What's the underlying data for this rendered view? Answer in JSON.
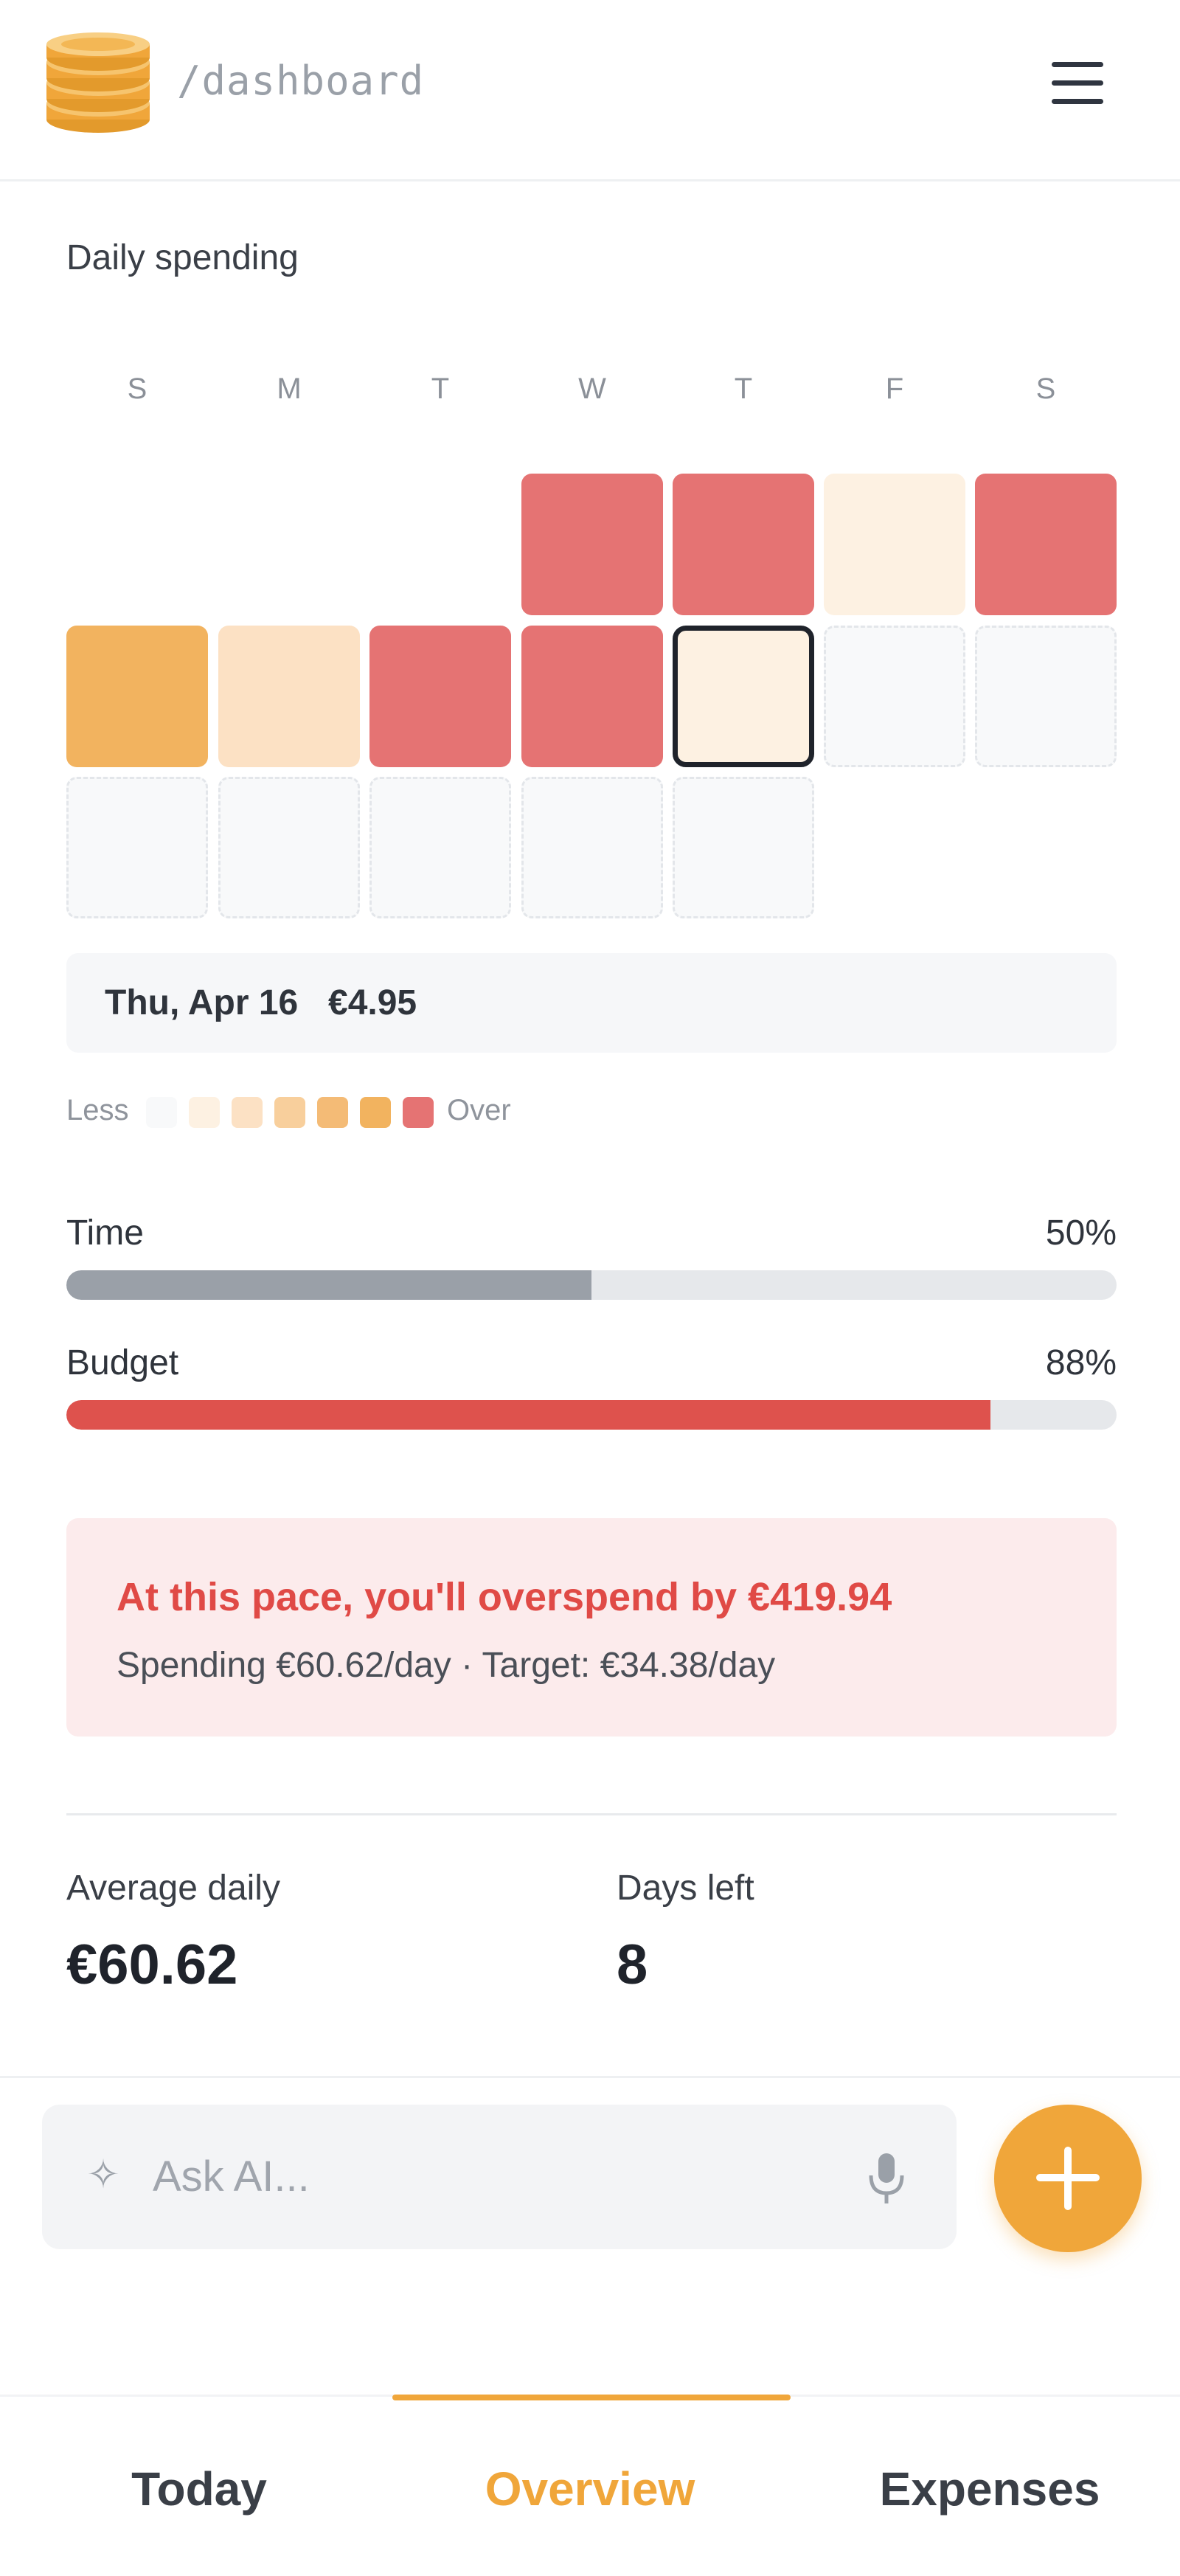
{
  "header": {
    "path": "/dashboard",
    "logo_icon": "coin-stack-icon",
    "menu_icon": "hamburger-menu-icon"
  },
  "daily_spending": {
    "title": "Daily spending",
    "weekdays": [
      "S",
      "M",
      "T",
      "W",
      "T",
      "F",
      "S"
    ],
    "colors": {
      "empty": "#f8f9fa",
      "level1": "#fdf1e2",
      "level2": "#fce1c4",
      "level3": "#f8cf9c",
      "level4": "#f4bb76",
      "level5": "#f2b35f",
      "over": "#e57373"
    },
    "weeks": [
      [
        "none",
        "none",
        "none",
        "over",
        "over",
        "level1",
        "over"
      ],
      [
        "level5",
        "level2",
        "over",
        "over",
        "level1-selected",
        "empty",
        "empty"
      ],
      [
        "empty",
        "empty",
        "empty",
        "empty",
        "empty",
        "none",
        "none"
      ]
    ],
    "selected": {
      "date": "Thu, Apr 16",
      "amount": "€4.95"
    },
    "legend": {
      "less": "Less",
      "over": "Over"
    }
  },
  "progress": {
    "time": {
      "label": "Time",
      "percent_text": "50%",
      "value": 0.5,
      "color": "#9aa0a8"
    },
    "budget": {
      "label": "Budget",
      "percent_text": "88%",
      "value": 0.88,
      "color": "#de524d"
    }
  },
  "warning": {
    "title": "At this pace, you'll overspend by €419.94",
    "subtitle": "Spending €60.62/day · Target: €34.38/day"
  },
  "stats": {
    "average_label": "Average daily",
    "average_value": "€60.62",
    "days_left_label": "Days left",
    "days_left_value": "8"
  },
  "ai": {
    "placeholder": "Ask AI...",
    "spark_icon": "sparkle-icon",
    "mic_icon": "microphone-icon",
    "add_icon": "plus-icon"
  },
  "nav": {
    "tabs": [
      {
        "label": "Today",
        "active": false
      },
      {
        "label": "Overview",
        "active": true
      },
      {
        "label": "Expenses",
        "active": false
      }
    ]
  }
}
